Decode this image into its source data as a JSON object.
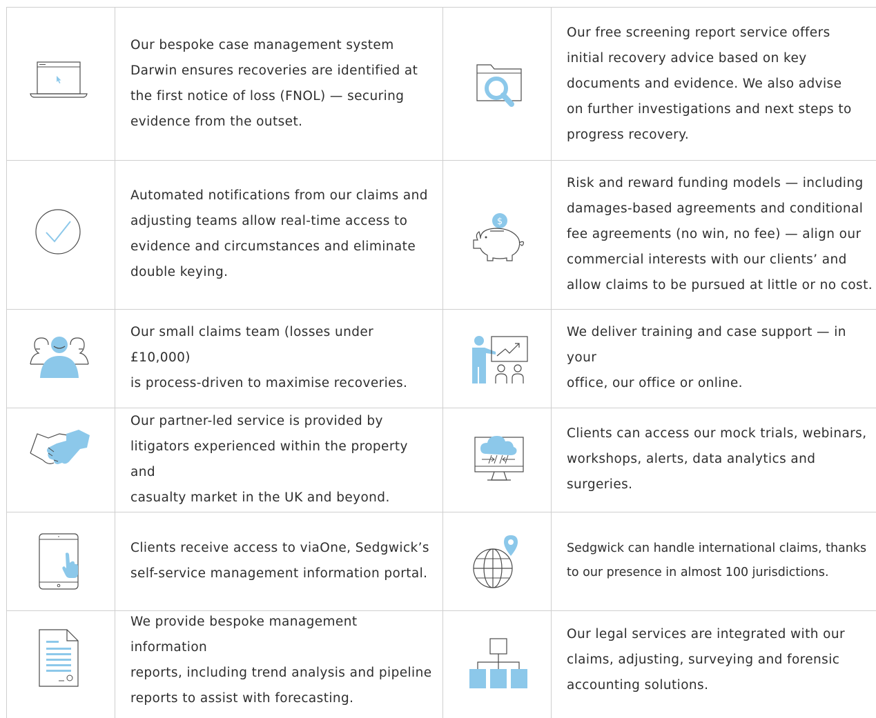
{
  "colors": {
    "accent": "#8cc8ea",
    "line": "#4a4a4a",
    "divider": "#cfcfcf",
    "text": "#2e2e2e"
  },
  "rows": [
    {
      "left": {
        "icon": "laptop-cursor-icon",
        "text": "Our bespoke case management system\nDarwin ensures recoveries are identified at\nthe first notice of loss (FNOL) — securing\nevidence from the outset."
      },
      "right": {
        "icon": "folder-search-icon",
        "text": "Our free screening report service offers\ninitial recovery advice based on key\ndocuments and evidence. We also advise\non further investigations and next steps to\nprogress recovery."
      }
    },
    {
      "left": {
        "icon": "checkmark-circle-icon",
        "text": "Automated notifications from our claims and\nadjusting teams allow real-time access to\nevidence and circumstances and eliminate\ndouble keying."
      },
      "right": {
        "icon": "piggy-bank-icon",
        "text": "Risk and reward funding models — including\ndamages-based agreements and conditional\nfee agreements (no win, no fee) — align our\ncommercial interests with our clients’ and\nallow claims to be pursued at little or no cost."
      }
    },
    {
      "left": {
        "icon": "team-people-icon",
        "text": "Our small claims team (losses under £10,000)\nis process-driven to maximise recoveries."
      },
      "right": {
        "icon": "presentation-training-icon",
        "text": "We deliver training and case support — in your\noffice, our office or online."
      }
    },
    {
      "left": {
        "icon": "handshake-icon",
        "text": "Our partner-led service is provided by\nlitigators experienced within the property and\ncasualty market in the UK and beyond."
      },
      "right": {
        "icon": "cloud-monitor-icon",
        "text": "Clients can access our mock trials, webinars,\nworkshops, alerts, data analytics and surgeries."
      }
    },
    {
      "left": {
        "icon": "tablet-touch-icon",
        "text": "Clients receive access to viaOne, Sedgwick’s\nself-service management information portal."
      },
      "right": {
        "icon": "globe-pin-icon",
        "text": "Sedgwick can handle international claims, thanks\nto our presence in almost 100 jurisdictions."
      }
    },
    {
      "left": {
        "icon": "document-report-icon",
        "text": "We provide bespoke management information\nreports, including trend analysis and pipeline\nreports to assist with forecasting."
      },
      "right": {
        "icon": "org-chart-icon",
        "text": "Our legal services are integrated with our\nclaims, adjusting, surveying and forensic\naccounting solutions."
      }
    }
  ]
}
